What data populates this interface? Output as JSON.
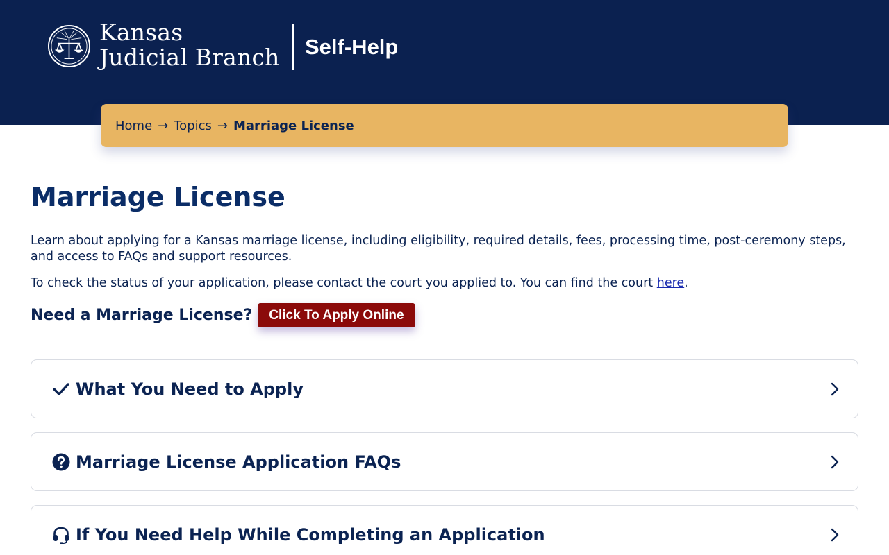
{
  "header": {
    "brand_line1": "Kansas",
    "brand_line2": "Judicial Branch",
    "section": "Self-Help",
    "logo_icon": "scales-of-justice-seal-icon",
    "background_color": "#0b2150"
  },
  "breadcrumb": {
    "home": "Home",
    "separator": "→",
    "topics": "Topics",
    "current": "Marriage License",
    "background_color": "#e8b562"
  },
  "main": {
    "title": "Marriage License",
    "intro": "Learn about applying for a Kansas marriage license, including eligibility, required details, fees, processing time, post-ceremony steps, and access to FAQs and support resources.",
    "status_text": "To check the status of your application, please contact the court you applied to. You can find the court ",
    "status_link": "here",
    "status_end": ".",
    "need_label": "Need a Marriage License?",
    "apply_button": "Click To Apply Online",
    "apply_button_color": "#8b0a0a"
  },
  "accordions": [
    {
      "title": "What You Need to Apply",
      "icon": "checkmark-icon"
    },
    {
      "title": "Marriage License Application FAQs",
      "icon": "question-circle-icon"
    },
    {
      "title": "If You Need Help While Completing an Application",
      "icon": "headset-icon"
    }
  ]
}
